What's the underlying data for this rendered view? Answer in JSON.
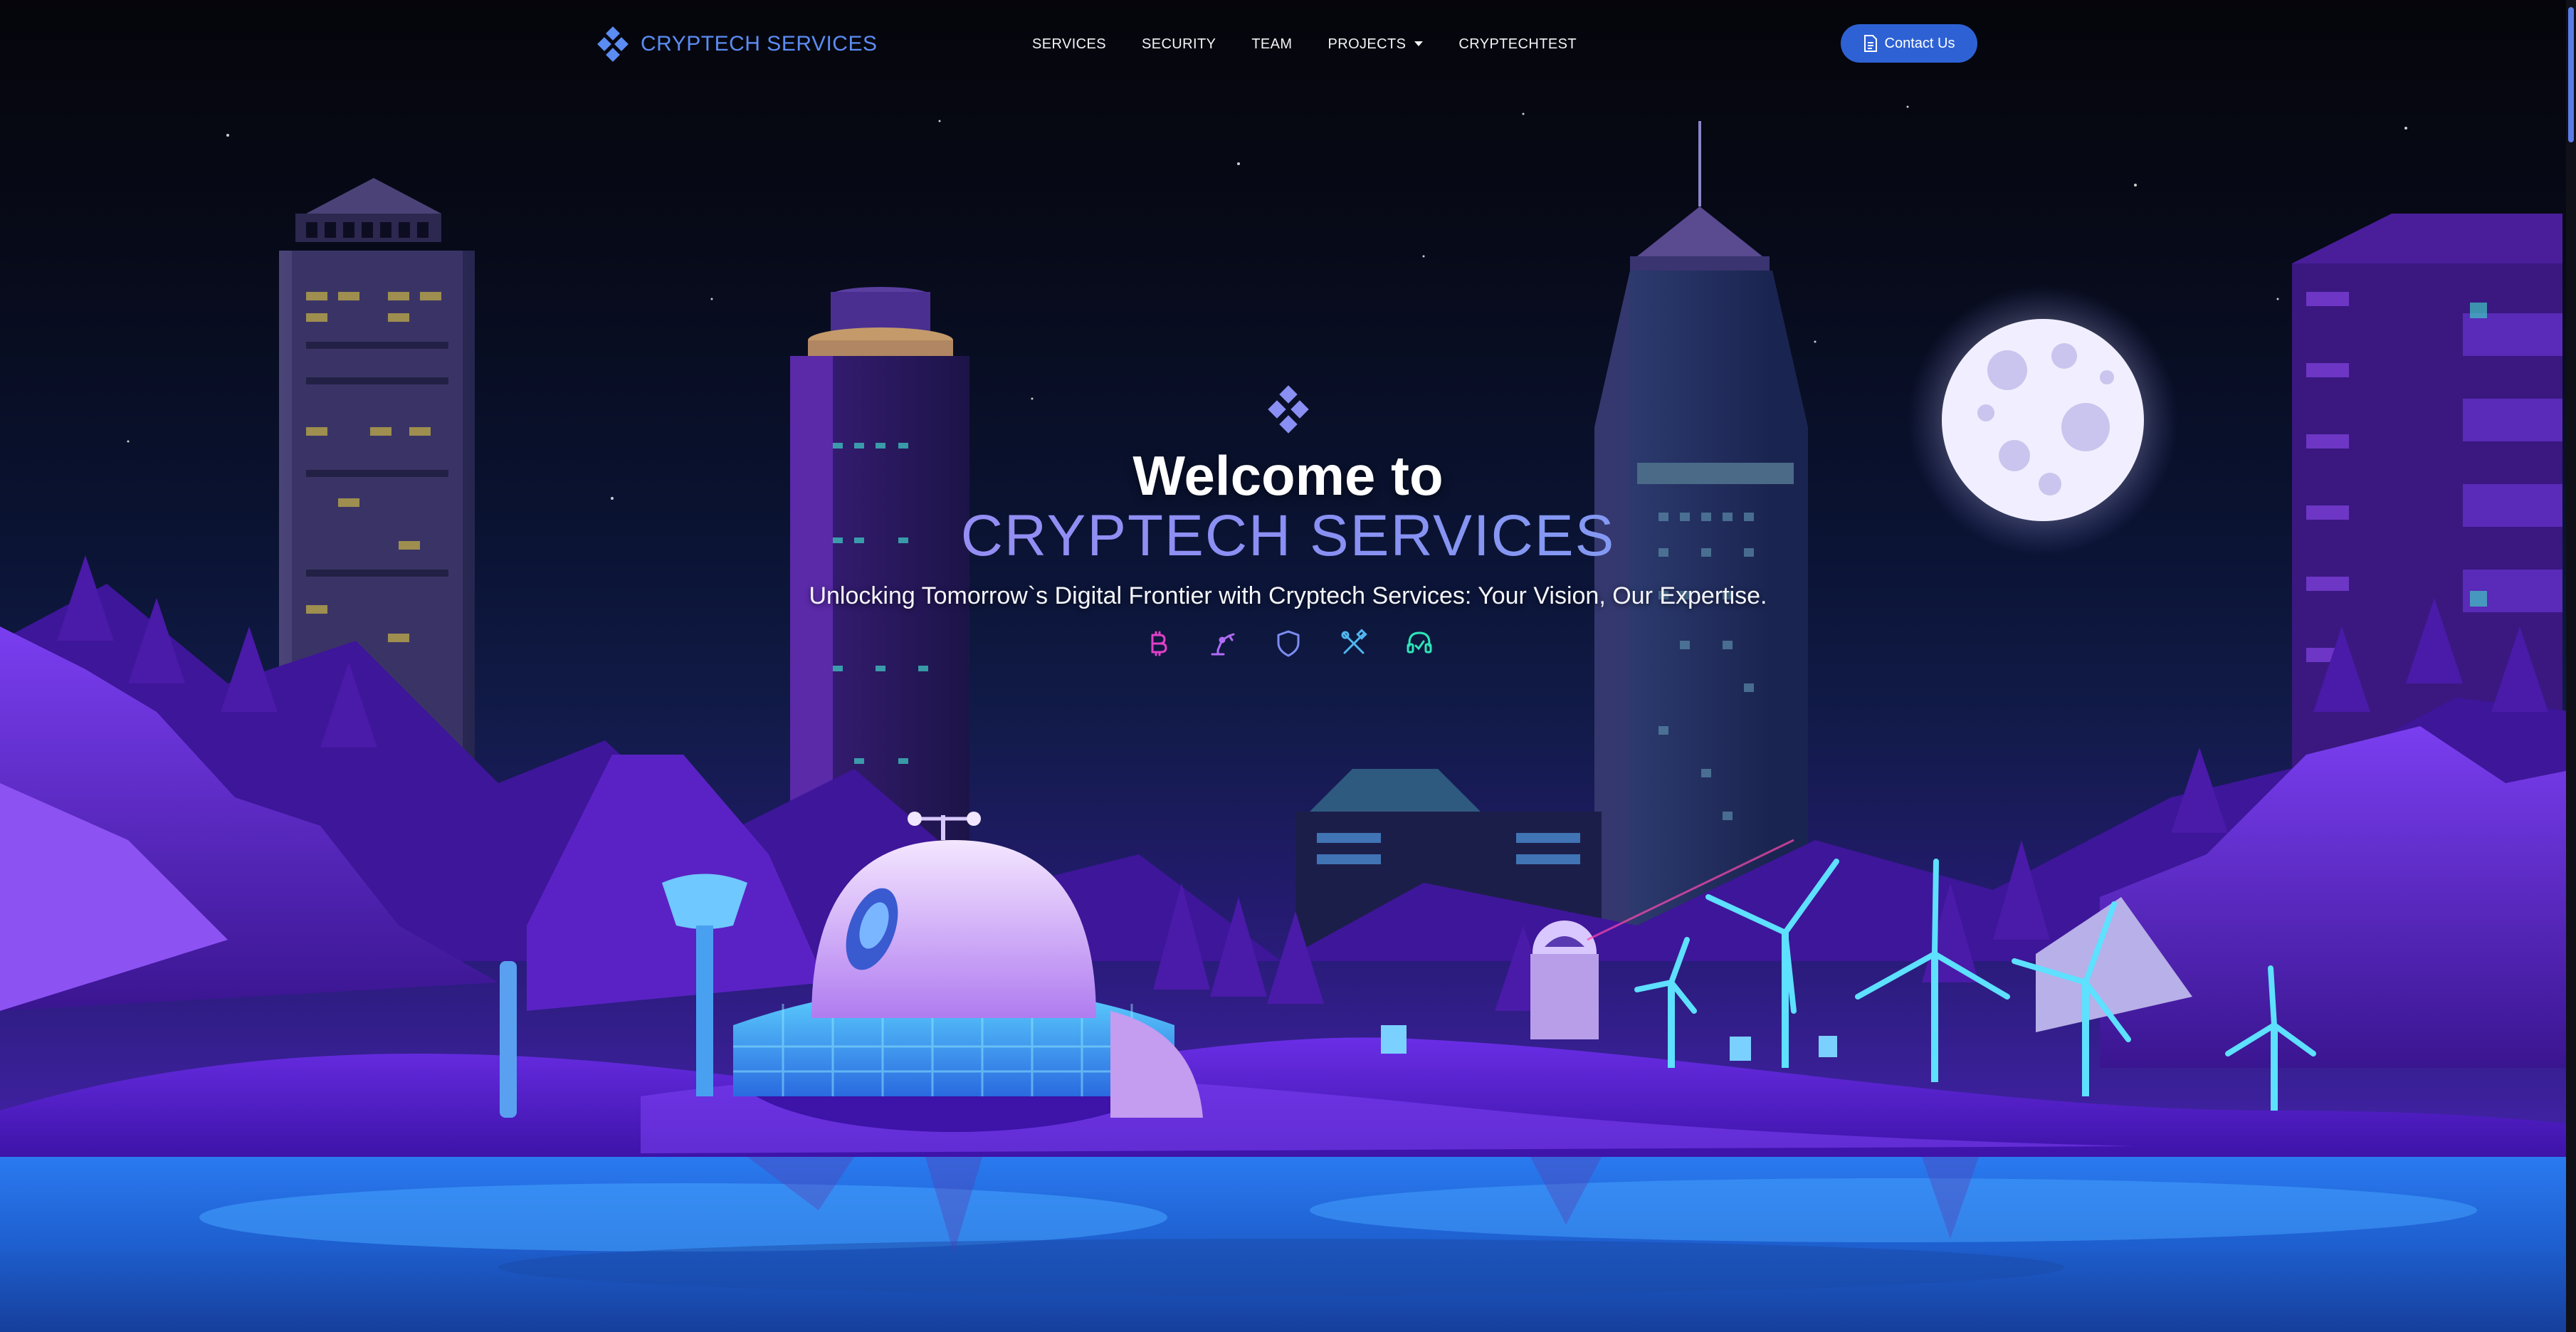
{
  "brand": {
    "name": "CRYPTECH SERVICES",
    "logo_icon": "diamond-grid-icon"
  },
  "nav": {
    "items": [
      {
        "label": "SERVICES"
      },
      {
        "label": "SECURITY"
      },
      {
        "label": "TEAM"
      },
      {
        "label": "PROJECTS",
        "has_dropdown": true
      },
      {
        "label": "CRYPTECHTEST"
      }
    ],
    "contact_label": "Contact Us",
    "contact_icon": "document-icon"
  },
  "hero": {
    "welcome": "Welcome to",
    "brand": "CRYPTECH SERVICES",
    "tagline": "Unlocking Tomorrow`s Digital Frontier with Cryptech Services: Your Vision, Our Expertise.",
    "icons": [
      {
        "name": "bitcoin-icon",
        "color": "#e040c8"
      },
      {
        "name": "robot-arm-icon",
        "color": "#b06cf5"
      },
      {
        "name": "shield-icon",
        "color": "#7d8cf2"
      },
      {
        "name": "tools-icon",
        "color": "#4fb6ee"
      },
      {
        "name": "headset-icon",
        "color": "#2ee6b8"
      }
    ]
  },
  "colors": {
    "accent": "#2e62d4",
    "brand_blue": "#5b8cf2",
    "background": "#05050b"
  }
}
